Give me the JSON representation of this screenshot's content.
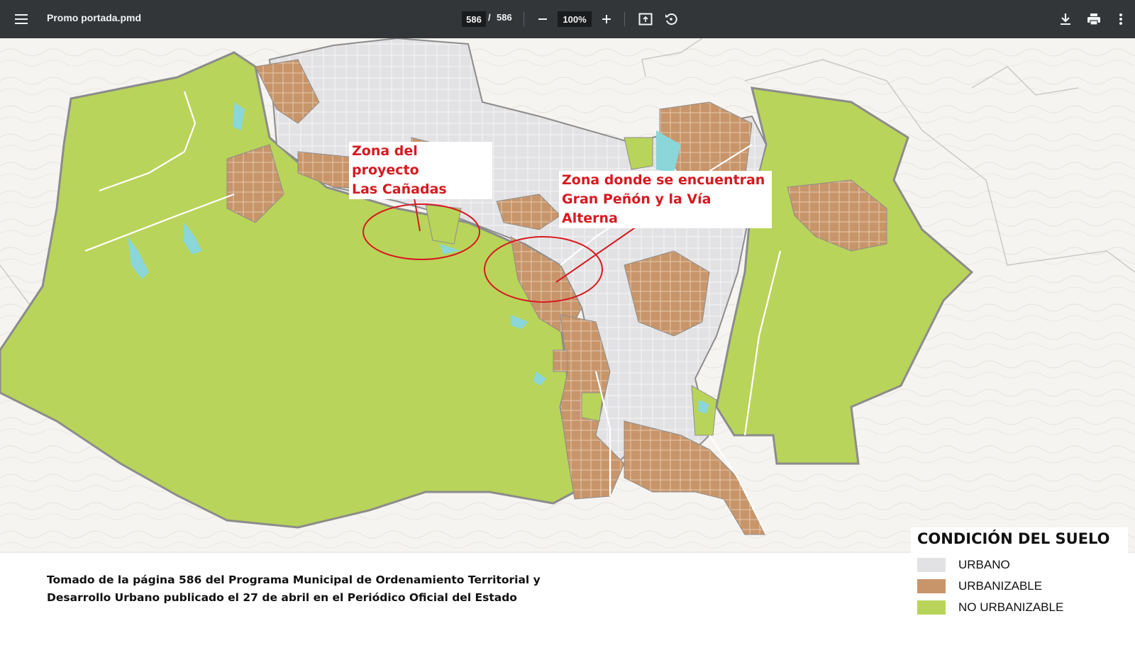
{
  "toolbar": {
    "title": "Promo portada.pmd",
    "current_page": "586",
    "page_separator": "/",
    "total_pages": "586",
    "zoom": "100%",
    "icons": [
      "menu-icon",
      "zoom-out-icon",
      "zoom-in-icon",
      "fit-page-icon",
      "rotate-icon",
      "download-icon",
      "print-icon",
      "more-vert-icon"
    ]
  },
  "map": {
    "callouts": [
      {
        "line1": "Zona del proyecto",
        "line2": "Las Cañadas"
      },
      {
        "line1": "Zona donde se encuentran",
        "line2": "Gran Peñón y la Vía Alterna"
      }
    ],
    "caption_line1": "Tomado de la página 586 del Programa Municipal de Ordenamiento Territorial y",
    "caption_line2": "Desarrollo Urbano publicado el 27 de abril en el Periódico Oficial del Estado",
    "legend": {
      "title": "CONDICIÓN DEL SUELO",
      "items": [
        {
          "label": "URBANO",
          "color": "#e2e2e4"
        },
        {
          "label": "URBANIZABLE",
          "color": "#c8956a"
        },
        {
          "label": "NO URBANIZABLE",
          "color": "#b9d45a"
        }
      ]
    },
    "colors": {
      "urbano": "#e2e2e4",
      "urbanizable": "#c8956a",
      "no_urbanizable": "#b9d45a",
      "water": "#8ad6d8",
      "boundary": "#8c8c8c",
      "annotation": "#d71920"
    }
  }
}
